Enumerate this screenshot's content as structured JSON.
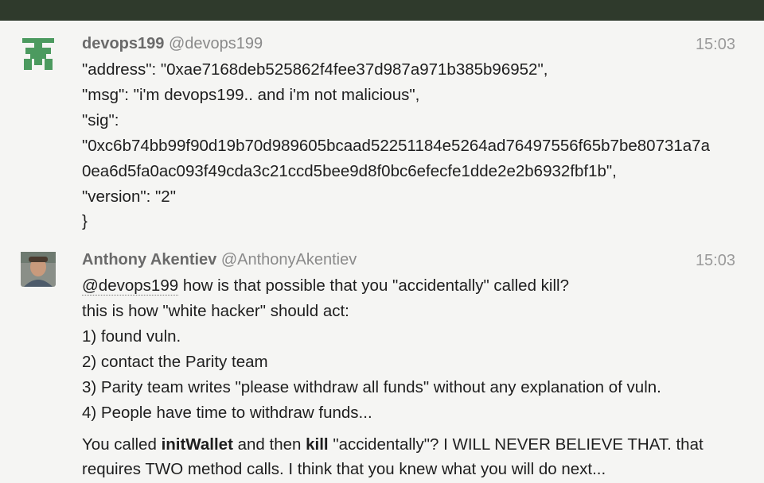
{
  "messages": [
    {
      "author": "devops199",
      "handle": "@devops199",
      "time": "15:03",
      "avatar": "identicon-green",
      "lines": [
        "\"address\": \"0xae7168deb525862f4fee37d987a971b385b96952\",",
        "\"msg\": \"i'm devops199.. and i'm not malicious\",",
        "\"sig\":",
        "\"0xc6b74bb99f90d19b70d989605bcaad52251184e5264ad76497556f65b7be80731a7a",
        "0ea6d5fa0ac093f49cda3c21ccd5bee9d8f0bc6efecfe1dde2e2b6932fbf1b\",",
        "\"version\": \"2\"",
        "}"
      ]
    },
    {
      "author": "Anthony Akentiev",
      "handle": "@AnthonyAkentiev",
      "time": "15:03",
      "avatar": "user-photo",
      "mention": "@devops199",
      "first_line_rest": " how is that possible that you \"accidentally\" called kill?",
      "lines": [
        "this is how \"white hacker\" should act:",
        "1) found vuln.",
        "2) contact the Parity team",
        "3) Parity team writes \"please withdraw all funds\" without any explanation of vuln.",
        "4) People have time to withdraw funds..."
      ],
      "closing": {
        "part1": "You called ",
        "bold1": "initWallet",
        "part2": " and then ",
        "bold2": "kill",
        "part3": " \"accidentally\"? I WILL NEVER BELIEVE THAT. that",
        "line2": "requires TWO method calls. I think that you knew what you will do next..."
      }
    }
  ]
}
